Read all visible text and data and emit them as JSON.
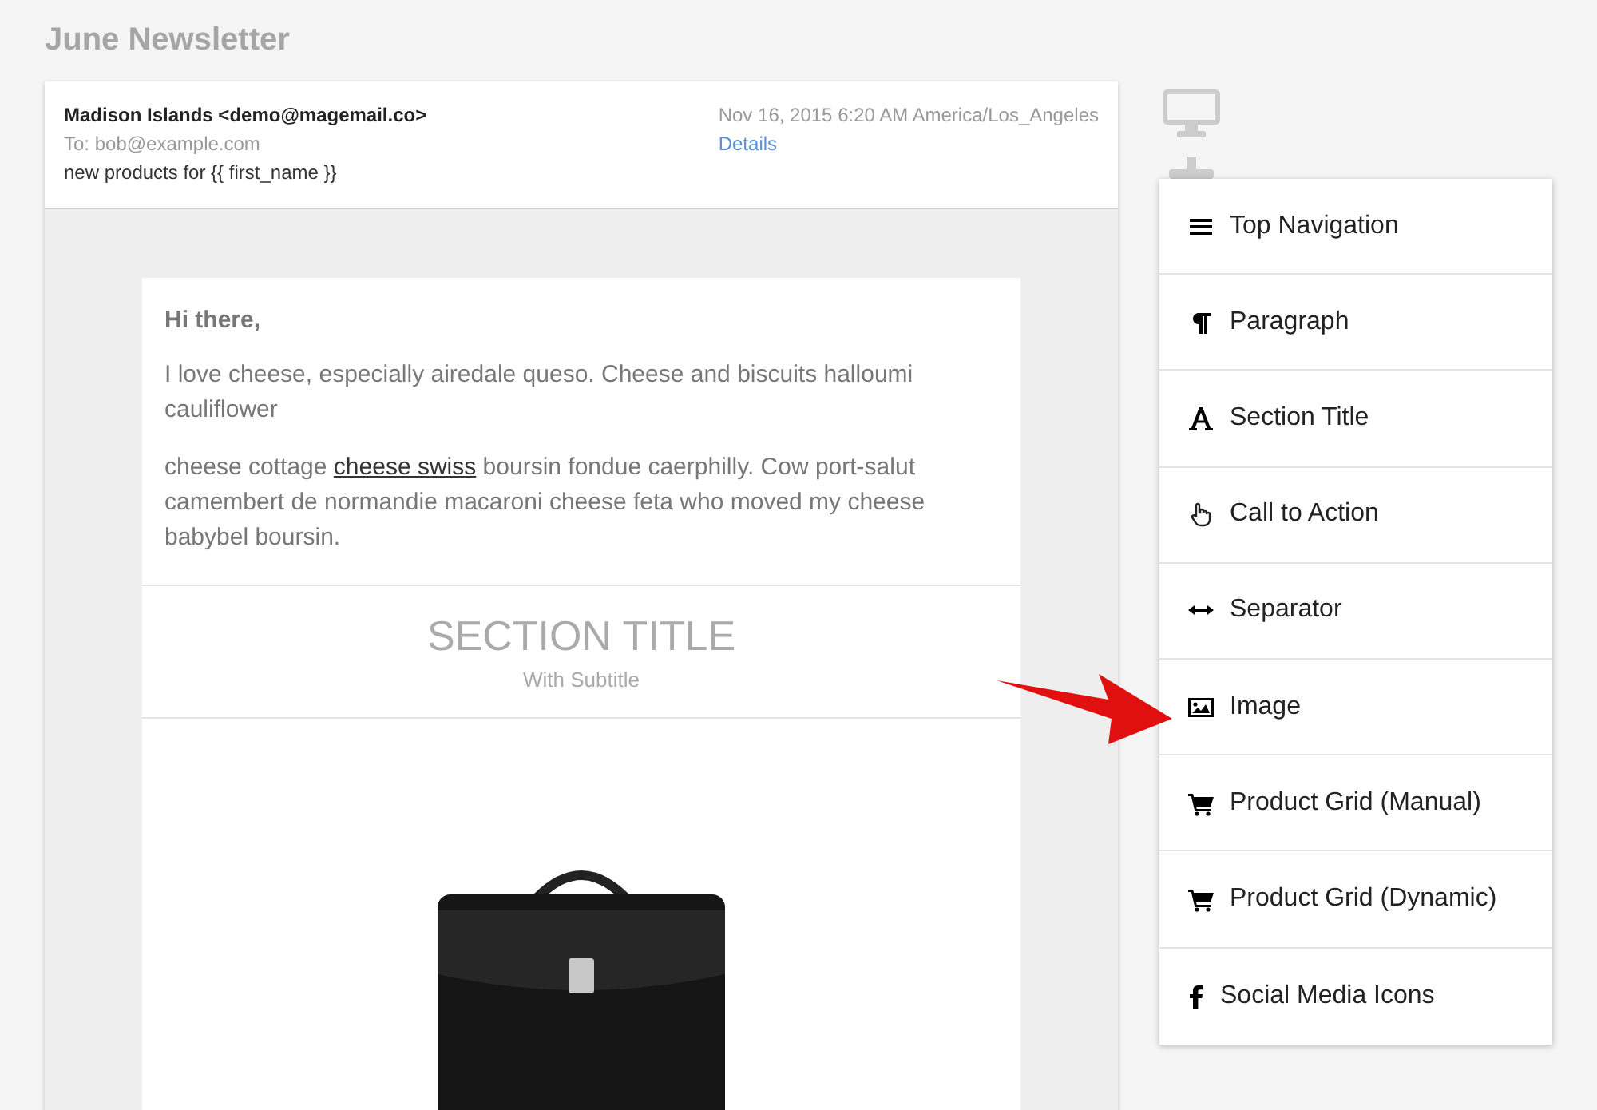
{
  "page_title": "June Newsletter",
  "email": {
    "from": "Madison Islands <demo@magemail.co>",
    "to": "To: bob@example.com",
    "subject": "new products for {{ first_name }}",
    "date": "Nov 16, 2015 6:20 AM America/Los_Angeles",
    "details_link": "Details"
  },
  "body": {
    "greeting": "Hi there,",
    "paragraph_1": "I love cheese, especially airedale queso. Cheese and biscuits halloumi cauliflower",
    "paragraph_2": {
      "before": "cheese cottage ",
      "link": "cheese swiss",
      "after": " boursin fondue caerphilly. Cow port-salut camembert de normandie macaroni cheese feta who moved my cheese babybel boursin."
    },
    "section_title": "SECTION TITLE",
    "section_subtitle": "With Subtitle"
  },
  "blocks_menu": [
    {
      "kind": "nav",
      "label": "Top Navigation"
    },
    {
      "kind": "paragraph",
      "label": "Paragraph"
    },
    {
      "kind": "title",
      "label": "Section Title"
    },
    {
      "kind": "action",
      "label": "Call to Action"
    },
    {
      "kind": "separator",
      "label": "Separator"
    },
    {
      "kind": "image",
      "label": "Image"
    },
    {
      "kind": "cart",
      "label": "Product Grid (Manual)"
    },
    {
      "kind": "cart",
      "label": "Product Grid (Dynamic)"
    },
    {
      "kind": "social",
      "label": "Social Media Icons"
    }
  ]
}
